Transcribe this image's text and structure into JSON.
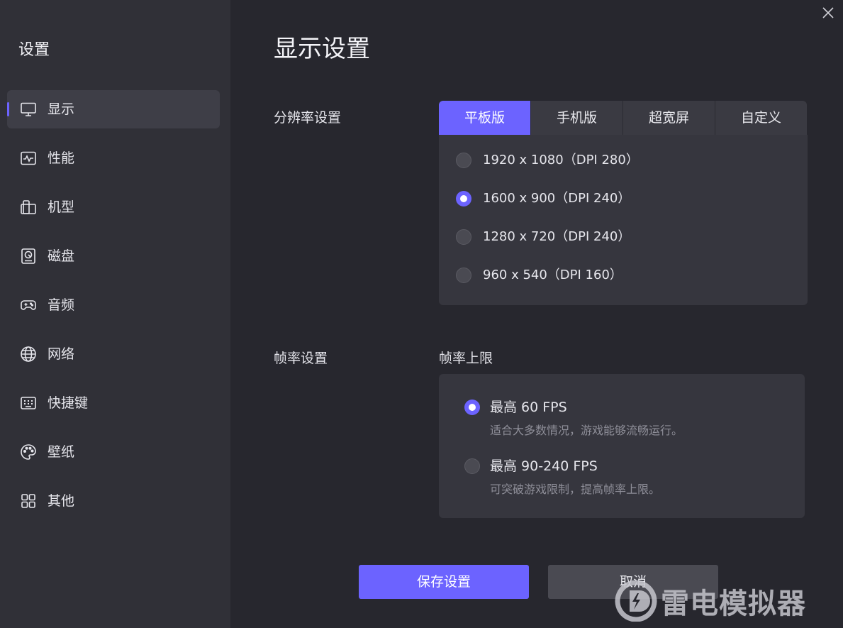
{
  "sidebar": {
    "title": "设置",
    "items": [
      {
        "label": "显示",
        "icon": "monitor-icon",
        "active": true
      },
      {
        "label": "性能",
        "icon": "performance-icon",
        "active": false
      },
      {
        "label": "机型",
        "icon": "device-icon",
        "active": false
      },
      {
        "label": "磁盘",
        "icon": "disk-icon",
        "active": false
      },
      {
        "label": "音频",
        "icon": "gamepad-icon",
        "active": false
      },
      {
        "label": "网络",
        "icon": "globe-icon",
        "active": false
      },
      {
        "label": "快捷键",
        "icon": "keyboard-icon",
        "active": false
      },
      {
        "label": "壁纸",
        "icon": "palette-icon",
        "active": false
      },
      {
        "label": "其他",
        "icon": "grid-icon",
        "active": false
      }
    ]
  },
  "main": {
    "title": "显示设置",
    "resolution": {
      "label": "分辨率设置",
      "tabs": [
        "平板版",
        "手机版",
        "超宽屏",
        "自定义"
      ],
      "active_tab": 0,
      "options": [
        {
          "text": "1920 x 1080（DPI 280）",
          "selected": false
        },
        {
          "text": "1600 x 900（DPI 240）",
          "selected": true
        },
        {
          "text": "1280 x 720（DPI 240）",
          "selected": false
        },
        {
          "text": "960 x 540（DPI 160）",
          "selected": false
        }
      ]
    },
    "fps": {
      "label": "帧率设置",
      "sub_label": "帧率上限",
      "options": [
        {
          "title": "最高 60 FPS",
          "desc": "适合大多数情况，游戏能够流畅运行。",
          "selected": true
        },
        {
          "title": "最高 90-240 FPS",
          "desc": "可突破游戏限制，提高帧率上限。",
          "selected": false
        }
      ]
    },
    "buttons": {
      "save": "保存设置",
      "cancel": "取消"
    }
  },
  "watermark": {
    "text": "雷电模拟器"
  },
  "colors": {
    "accent": "#6c63ff",
    "sidebar_bg": "#303037",
    "main_bg": "#27272e",
    "panel_bg": "#36363e"
  }
}
